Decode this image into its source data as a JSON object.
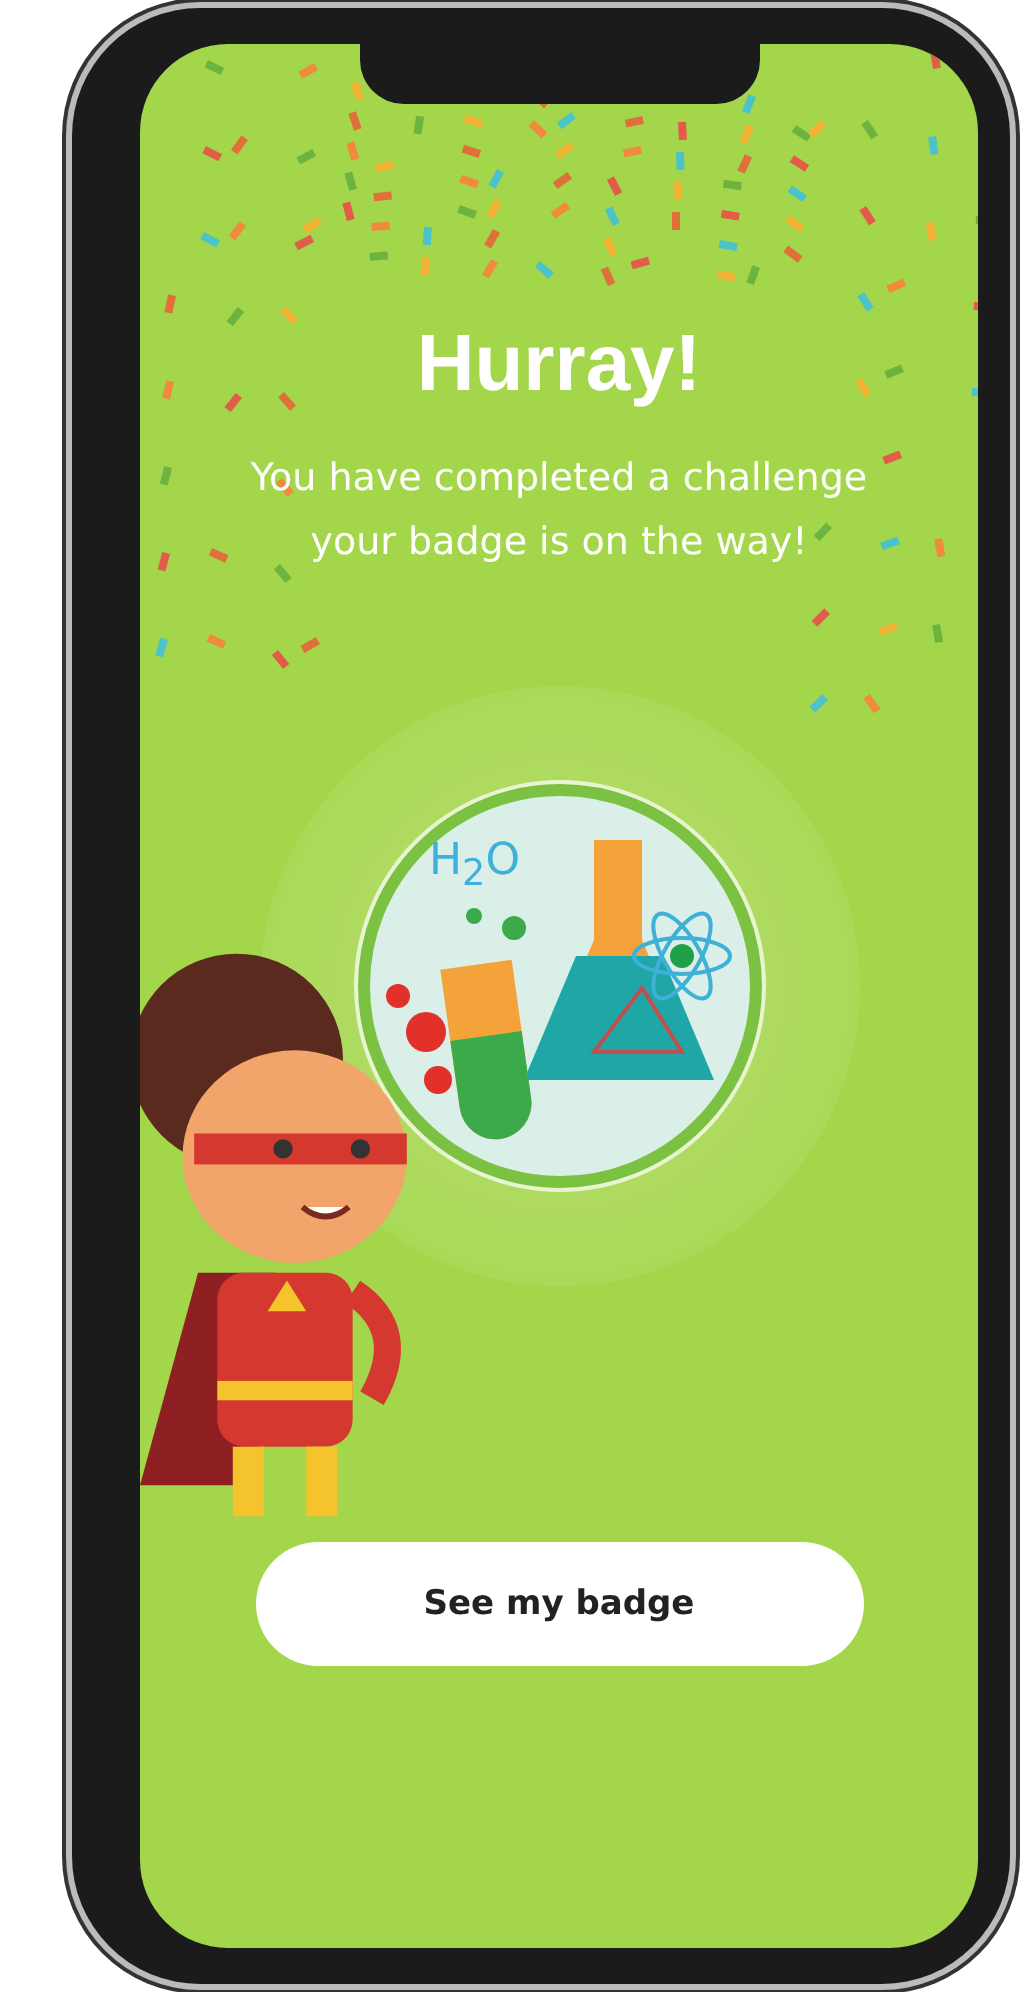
{
  "screen": {
    "title": "Hurray!",
    "message_lines": [
      "You have completed a challenge",
      "your badge is on the way!"
    ],
    "badge": {
      "label": "H$_{2}$O"
    },
    "button": {
      "label": "See my badge"
    }
  }
}
